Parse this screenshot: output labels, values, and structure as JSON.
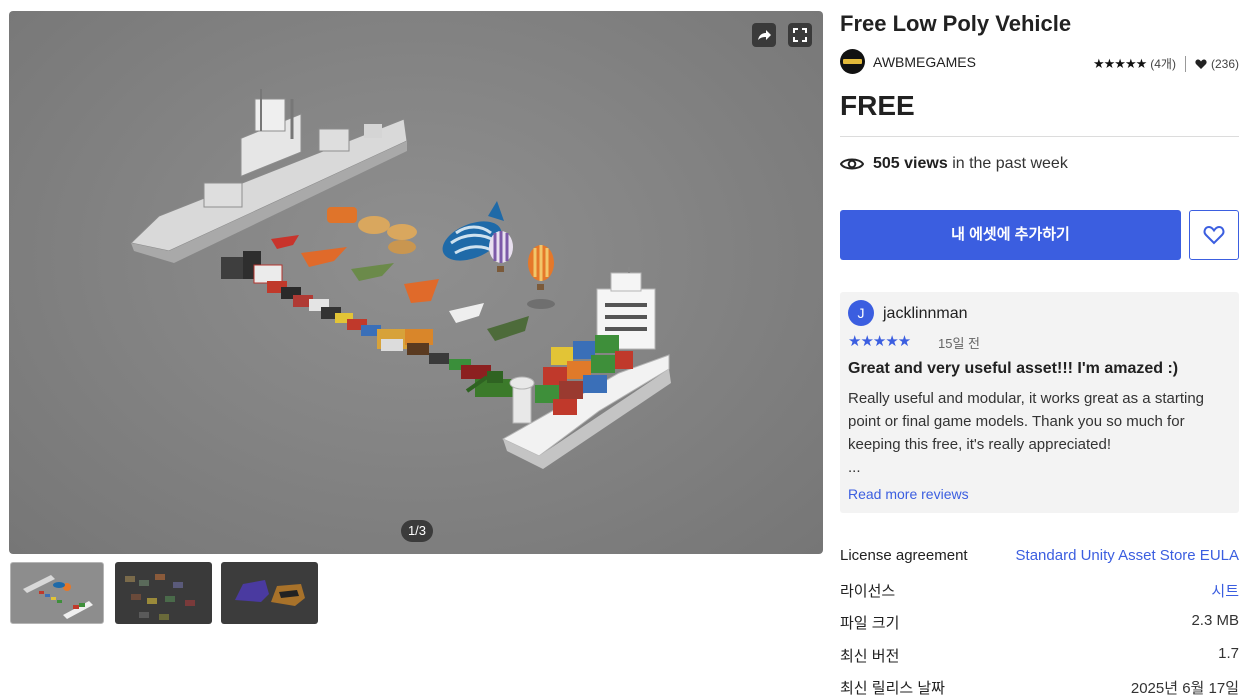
{
  "viewer": {
    "counter": "1/3",
    "share_icon": "share-arrow-icon",
    "fullscreen_icon": "fullscreen-icon",
    "thumbnails": [
      "thumbnail-vehicles-overview",
      "thumbnail-vehicles-dark",
      "thumbnail-cars"
    ]
  },
  "product": {
    "title": "Free Low Poly Vehicle",
    "publisher": "AWBMEGAMES",
    "stars": "★★★★★",
    "rating_count": "(4개)",
    "favorites": "(236)",
    "price": "FREE",
    "views_count": "505 views",
    "views_suffix": "in the past week",
    "add_button": "내 에셋에 추가하기"
  },
  "review": {
    "avatar_letter": "J",
    "author": "jacklinnman",
    "stars": "★★★★★",
    "time": "15일 전",
    "title": "Great and very useful asset!!! I'm amazed :)",
    "body": "Really useful and modular, it works great as a starting point or final game models. Thank you so much for keeping this free, it's really appreciated!",
    "ellipsis": "...",
    "read_more": "Read more reviews"
  },
  "meta": [
    {
      "key": "License agreement",
      "value": "Standard Unity Asset Store EULA"
    },
    {
      "key": "라이선스",
      "value": "시트"
    },
    {
      "key": "파일 크기",
      "value": "2.3 MB"
    },
    {
      "key": "최신 버전",
      "value": "1.7"
    },
    {
      "key": "최신 릴리스 날짜",
      "value": "2025년 6월 17일"
    }
  ],
  "colors": {
    "accent": "#3b5ee0",
    "review_bg": "#f3f3f3"
  }
}
